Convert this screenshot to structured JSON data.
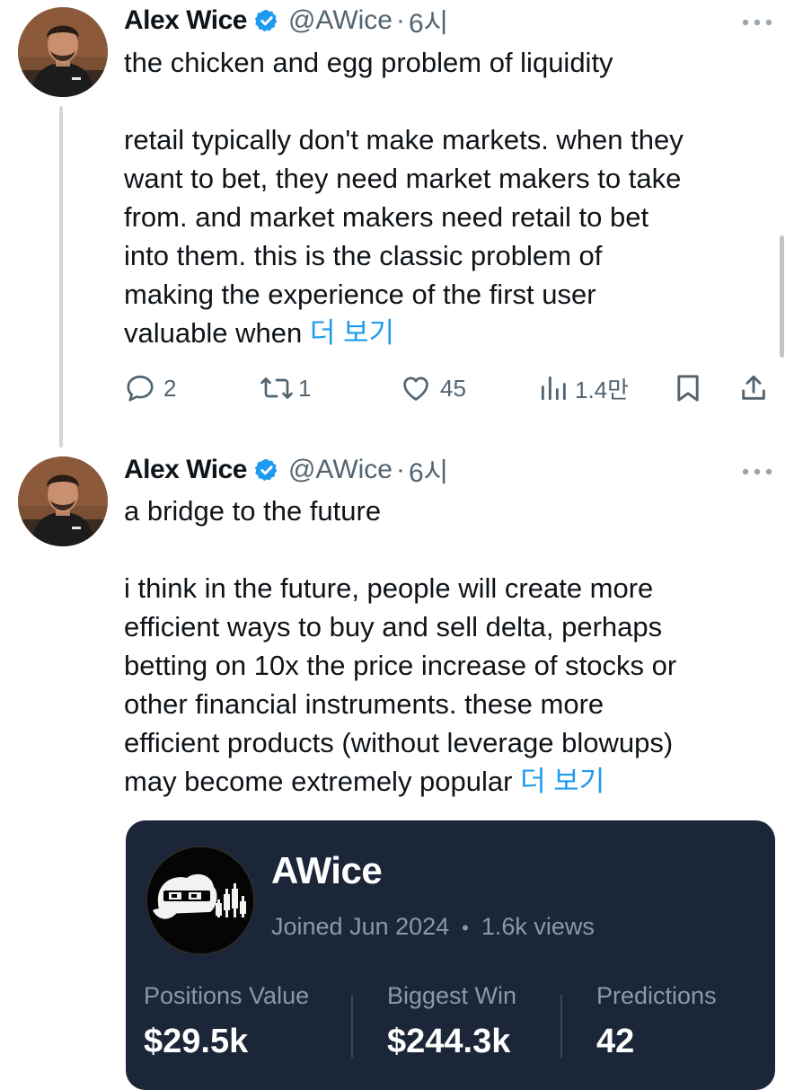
{
  "tweets": [
    {
      "author_name": "Alex Wice",
      "handle": "@AWice",
      "separator": "·",
      "time": "6시",
      "title_line": "the chicken and egg problem of liquidity",
      "body_lines": [
        "retail typically don't make markets.  when they",
        "want to bet, they need market makers to take",
        "from.  and market makers need retail to bet",
        "into them.  this is the classic problem of",
        "making the experience of the first user"
      ],
      "last_line": "valuable when ",
      "show_more": "더 보기",
      "actions": {
        "replies": "2",
        "reposts": "1",
        "likes": "45",
        "views": "1.4만"
      }
    },
    {
      "author_name": "Alex Wice",
      "handle": "@AWice",
      "separator": "·",
      "time": "6시",
      "title_line": "a bridge to the future",
      "body_lines": [
        "i think in the future, people will create more",
        "efficient ways to buy and sell delta, perhaps",
        "betting on 10x the price increase of stocks or",
        "other financial instruments.  these more",
        "efficient products (without leverage blowups)"
      ],
      "last_line": "may become extremely popular ",
      "show_more": "더 보기"
    }
  ],
  "profile_card": {
    "name": "AWice",
    "joined": "Joined Jun 2024",
    "separator": "•",
    "views": "1.6k views",
    "stats": [
      {
        "label": "Positions Value",
        "value": "$29.5k"
      },
      {
        "label": "Biggest Win",
        "value": "$244.3k"
      },
      {
        "label": "Predictions",
        "value": "42"
      }
    ]
  },
  "colors": {
    "link_blue": "#1d9bf0",
    "verified_blue": "#1d9bf0",
    "secondary_text": "#536471",
    "card_background": "#1b2638"
  },
  "icons": {
    "verified": "verified-badge-icon",
    "more": "more-options-icon",
    "reply": "reply-icon",
    "repost": "repost-icon",
    "like": "heart-icon",
    "views": "views-chart-icon",
    "bookmark": "bookmark-icon",
    "share": "share-icon"
  }
}
